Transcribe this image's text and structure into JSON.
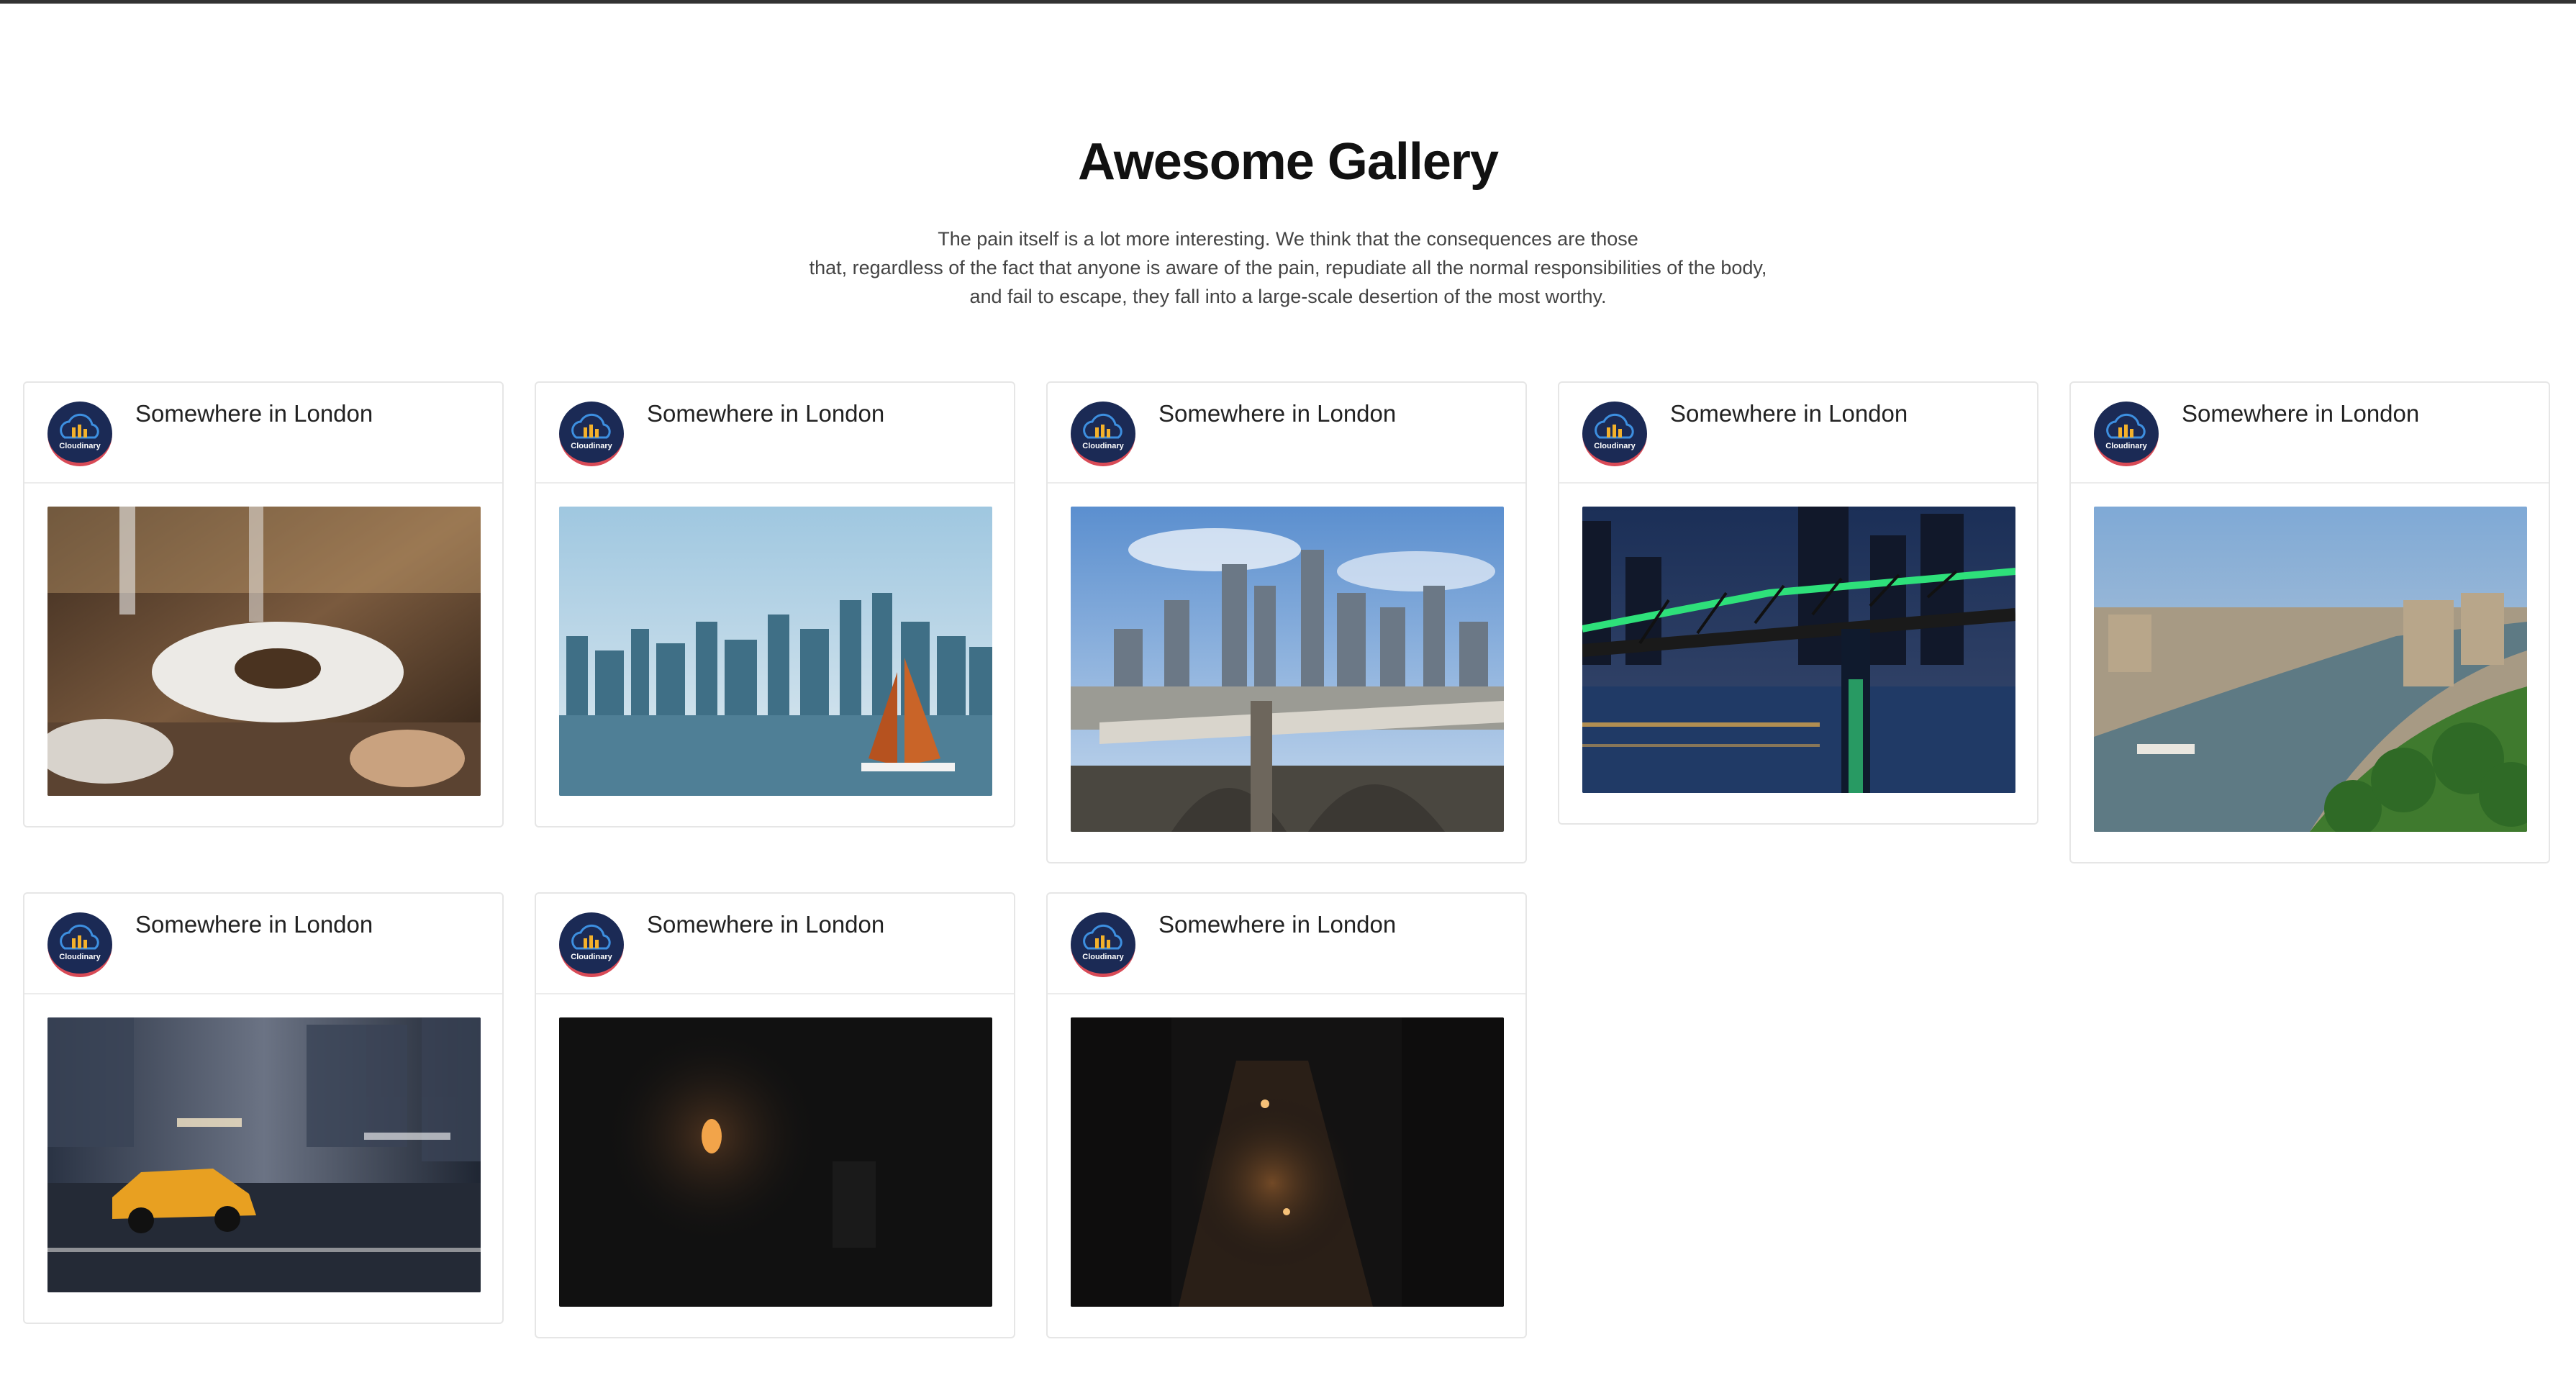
{
  "page": {
    "title": "Awesome Gallery",
    "description_lines": [
      "The pain itself is a lot more interesting. We think that the consequences are those",
      "that, regardless of the fact that anyone is aware of the pain, repudiate all the normal responsibilities of the body,",
      "and fail to escape, they fall into a large-scale desertion of the most worthy."
    ]
  },
  "brand": {
    "avatar_label": "Cloudinary",
    "avatar_bg": "#1b2a55",
    "avatar_accent": "#d84a56"
  },
  "cards": [
    {
      "title": "Somewhere in London",
      "photo": "restaurant-dinner-table"
    },
    {
      "title": "Somewhere in London",
      "photo": "city-skyline-sailboat"
    },
    {
      "title": "Somewhere in London",
      "photo": "city-bridge-skyline"
    },
    {
      "title": "Somewhere in London",
      "photo": "illuminated-bridge-night"
    },
    {
      "title": "Somewhere in London",
      "photo": "river-city-aerial"
    },
    {
      "title": "Somewhere in London",
      "photo": "yellow-taxi-motion-blur"
    },
    {
      "title": "Somewhere in London",
      "photo": "dark-wall-lamp"
    },
    {
      "title": "Somewhere in London",
      "photo": "dark-alley-night"
    }
  ]
}
